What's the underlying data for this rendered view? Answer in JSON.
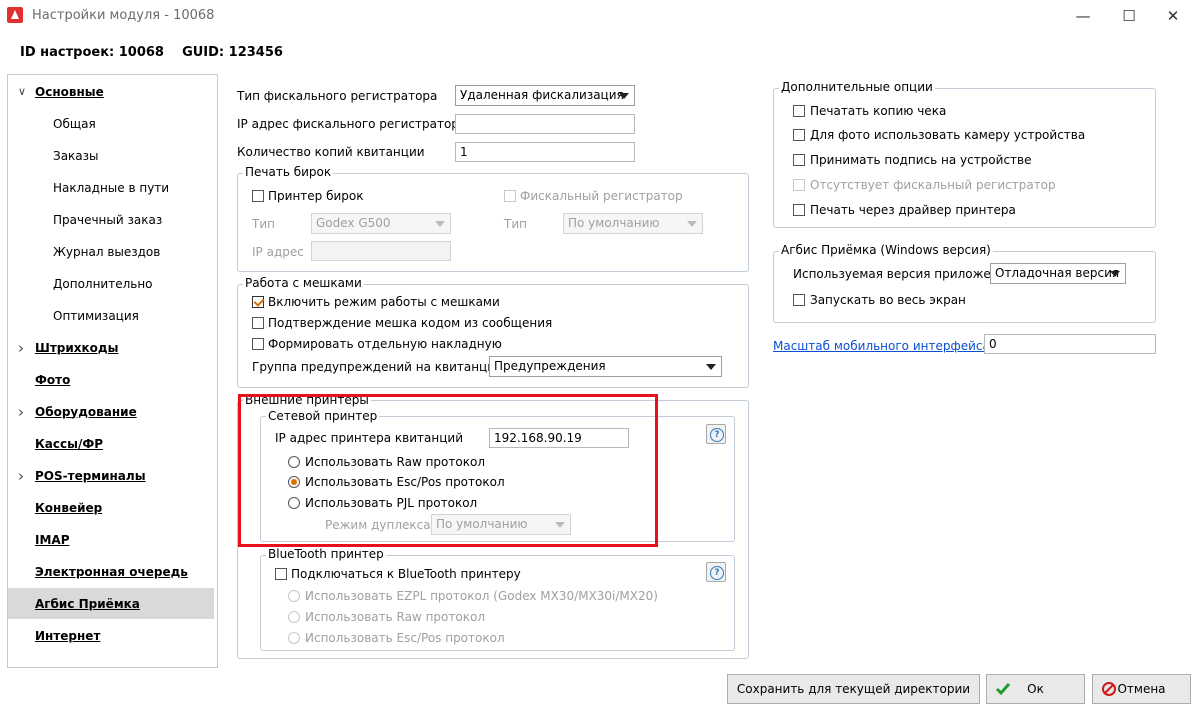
{
  "window": {
    "title": "Настройки модуля - 10068",
    "minimize_glyph": "—",
    "maximize_glyph": "☐",
    "close_glyph": "✕"
  },
  "header": {
    "text": "ID настроек: 10068    GUID: 123456"
  },
  "sidebar": {
    "items": [
      {
        "label": "Основные",
        "type": "main",
        "expanded": true
      },
      {
        "label": "Общая",
        "type": "sub"
      },
      {
        "label": "Заказы",
        "type": "sub"
      },
      {
        "label": "Накладные в пути",
        "type": "sub"
      },
      {
        "label": "Прачечный заказ",
        "type": "sub"
      },
      {
        "label": "Журнал выездов",
        "type": "sub"
      },
      {
        "label": "Дополнительно",
        "type": "sub"
      },
      {
        "label": "Оптимизация",
        "type": "sub"
      },
      {
        "label": "Штрихкоды",
        "type": "main",
        "collapsible": true
      },
      {
        "label": "Фото",
        "type": "main"
      },
      {
        "label": "Оборудование",
        "type": "main",
        "collapsible": true
      },
      {
        "label": "Кассы/ФР",
        "type": "main"
      },
      {
        "label": "POS-терминалы",
        "type": "main",
        "collapsible": true
      },
      {
        "label": "Конвейер",
        "type": "main"
      },
      {
        "label": "IMAP",
        "type": "main"
      },
      {
        "label": "Электронная очередь",
        "type": "main"
      },
      {
        "label": "Агбис Приёмка",
        "type": "main",
        "selected": true
      },
      {
        "label": "Интернет",
        "type": "main"
      }
    ]
  },
  "fiscal": {
    "type_label": "Тип фискального регистратора",
    "type_value": "Удаленная фискализация",
    "ip_label": "IP адрес фискального регистратора",
    "ip_value": "",
    "copies_label": "Количество копий квитанции",
    "copies_value": "1"
  },
  "tags_print": {
    "title": "Печать бирок",
    "tag_printer_label": "Принтер бирок",
    "fiscal_reg_label": "Фискальный регистратор",
    "type_label": "Тип",
    "type_value": "Godex G500",
    "type2_label": "Тип",
    "type2_value": "По умолчанию",
    "ip_label": "IP адрес",
    "ip_value": ""
  },
  "bags": {
    "title": "Работа с мешками",
    "enable_label": "Включить режим работы с мешками",
    "confirm_label": "Подтверждение мешка кодом из сообщения",
    "separate_label": "Формировать отдельную накладную",
    "group_label": "Группа предупреждений на квитанции",
    "group_value": "Предупреждения"
  },
  "external_printers": {
    "title": "Внешние принтеры",
    "network": {
      "title": "Сетевой принтер",
      "ip_label": "IP адрес принтера квитанций",
      "ip_value": "192.168.90.19",
      "raw_label": "Использовать Raw протокол",
      "escpos_label": "Использовать Esc/Pos протокол",
      "pjl_label": "Использовать PJL протокол",
      "duplex_label": "Режим дуплекса",
      "duplex_value": "По умолчанию",
      "help_glyph": "?"
    },
    "bluetooth": {
      "title": "BlueTooth принтер",
      "connect_label": "Подключаться к BlueTooth принтеру",
      "ezpl_label": "Использовать EZPL протокол (Godex MX30/MX30i/MX20)",
      "raw_label": "Использовать Raw протокол",
      "escpos_label": "Использовать Esc/Pos протокол",
      "help_glyph": "?"
    }
  },
  "extra_options": {
    "title": "Дополнительные опции",
    "print_copy_label": "Печатать копию чека",
    "camera_label": "Для фото использовать камеру устройства",
    "signature_label": "Принимать подпись на устройстве",
    "no_fiscal_label": "Отсутствует фискальный регистратор",
    "driver_label": "Печать через драйвер принтера"
  },
  "agbis_windows": {
    "title": "Агбис Приёмка (Windows версия)",
    "version_label": "Используемая версия приложения",
    "version_value": "Отладочная версия",
    "fullscreen_label": "Запускать во весь экран"
  },
  "mobile_scale": {
    "label": "Масштаб мобильного интерфейса",
    "value": "0"
  },
  "footer": {
    "save_dir_label": "Сохранить для текущей директории",
    "ok_label": "Ок",
    "cancel_label": "Отмена"
  }
}
